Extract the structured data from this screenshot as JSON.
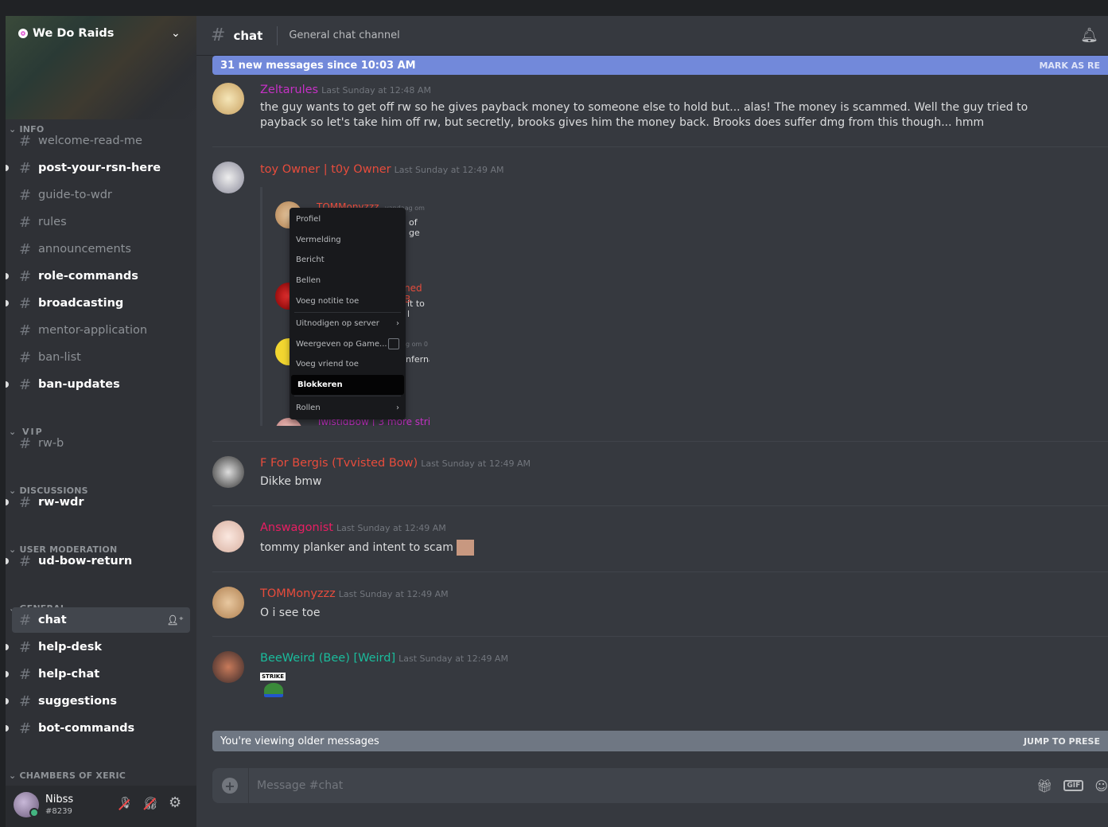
{
  "server": {
    "name": "We Do Raids"
  },
  "categories": {
    "info": "INFO",
    "vip": "VIP",
    "discussions": "DISCUSSIONS",
    "user_moderation": "USER MODERATION",
    "general": "GENERAL",
    "chambers": "CHAMBERS OF XERIC"
  },
  "channels": [
    {
      "name": "welcome-read-me",
      "state": "read"
    },
    {
      "name": "post-your-rsn-here",
      "state": "unread"
    },
    {
      "name": "guide-to-wdr",
      "state": "read"
    },
    {
      "name": "rules",
      "state": "read"
    },
    {
      "name": "announcements",
      "state": "read"
    },
    {
      "name": "role-commands",
      "state": "unread"
    },
    {
      "name": "broadcasting",
      "state": "unread"
    },
    {
      "name": "mentor-application",
      "state": "read"
    },
    {
      "name": "ban-list",
      "state": "read"
    },
    {
      "name": "ban-updates",
      "state": "unread"
    },
    {
      "name": "rw-b",
      "state": "read"
    },
    {
      "name": "rw-wdr",
      "state": "unread"
    },
    {
      "name": "ud-bow-return",
      "state": "unread"
    },
    {
      "name": "chat",
      "state": "selected"
    },
    {
      "name": "help-desk",
      "state": "unread"
    },
    {
      "name": "help-chat",
      "state": "unread"
    },
    {
      "name": "suggestions",
      "state": "unread"
    },
    {
      "name": "bot-commands",
      "state": "unread"
    }
  ],
  "user": {
    "name": "Nibss",
    "tag": "#8239",
    "status_color": "#43b581"
  },
  "header": {
    "channel": "chat",
    "topic": "General chat channel"
  },
  "new_messages": {
    "text": "31 new messages since 10:03 AM",
    "action": "MARK AS RE"
  },
  "messages": [
    {
      "author": "Zeltarules",
      "color": "#c531c5",
      "time": "Last Sunday at 12:48 AM",
      "text": "the guy wants to get off rw so he gives payback money to someone else to hold but... alas! The money is scammed. Well the guy tried to payback so let's take him off rw, but secretly, brooks gives him the money back. Brooks does suffer dmg from this though... hmm"
    },
    {
      "author": "toy Owner | t0y Owner",
      "color": "#e74c3c",
      "time": "Last Sunday at 12:49 AM",
      "text": ""
    },
    {
      "author": "F For Bergis (Tvvisted Bow)",
      "color": "#e74c3c",
      "time": "Last Sunday at 12:49 AM",
      "text": "Dikke bmw"
    },
    {
      "author": "Answagonist",
      "color": "#e91e63",
      "time": "Last Sunday at 12:49 AM",
      "text": "tommy planker and intent to scam"
    },
    {
      "author": "TOMMonyzzz",
      "color": "#e74c3c",
      "time": "Last Sunday at 12:49 AM",
      "text": "O i see toe"
    },
    {
      "author": "BeeWeird (Bee) [Weird]",
      "color": "#1abc9c",
      "time": "Last Sunday at 12:49 AM",
      "text": ""
    }
  ],
  "embed": {
    "fragments": {
      "name1": "TOMMonyzzz",
      "ts1": "vandaag om",
      "t1": "of ge",
      "name2": "ned B",
      "t2": "it to l",
      "ts3": "g om 0",
      "t3": "nferna",
      "name4": "TwistidBow | 3 more stri"
    },
    "context_menu": [
      "Profiel",
      "Vermelding",
      "Bericht",
      "Bellen",
      "Voeg notitie toe",
      "Uitnodigen op server",
      "Weergeven op Game...",
      "Voeg vriend toe",
      "Blokkeren",
      "Rollen"
    ]
  },
  "sticker": {
    "label": "STRIKE"
  },
  "older": {
    "text": "You're viewing older messages",
    "action": "JUMP TO PRESE"
  },
  "composer": {
    "placeholder": "Message #chat",
    "gif": "GIF"
  }
}
